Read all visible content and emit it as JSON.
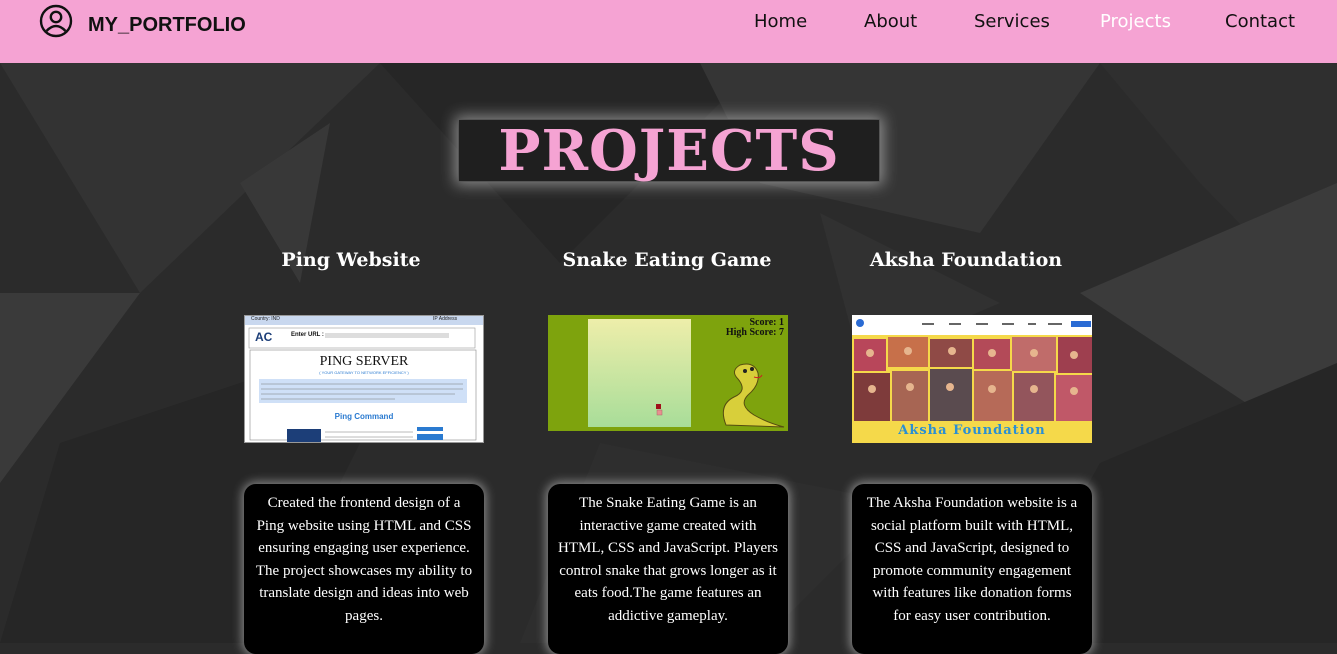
{
  "header": {
    "brand": "MY_PORTFOLIO",
    "brand_icon": "user-circle-icon",
    "nav": [
      {
        "label": "Home",
        "active": false
      },
      {
        "label": "About",
        "active": false
      },
      {
        "label": "Services",
        "active": false
      },
      {
        "label": "Projects",
        "active": true
      },
      {
        "label": "Contact",
        "active": false
      }
    ],
    "bg_color": "#f5a3d3"
  },
  "section": {
    "title": "PROJECTS",
    "title_color": "#f5a3d3"
  },
  "projects": [
    {
      "title": "Ping Website",
      "description": "Created the frontend design of a Ping website using HTML and CSS ensuring engaging user experience. The project showcases my ability to translate design and ideas into web pages.",
      "thumb": {
        "top_left": "Country: IND",
        "top_right": "IP Address",
        "logo": "AC",
        "url_label": "Enter URL :",
        "heading": "PING SERVER",
        "tagline": "( YOUR GATEWAY TO NETWORK EFFICIENCY )",
        "command": "Ping Command"
      }
    },
    {
      "title": "Snake Eating Game",
      "description": "The Snake Eating Game is an interactive game created with HTML, CSS and JavaScript. Players control snake that grows longer as it eats food.The game features an addictive gameplay.",
      "thumb": {
        "score": "Score: 1",
        "high_score": "High Score: 7"
      }
    },
    {
      "title": "Aksha Foundation",
      "description": "The Aksha Foundation website is a social platform built with HTML, CSS and JavaScript, designed to promote community engagement with features like donation forms for easy user contribution.",
      "thumb": {
        "caption": "Aksha Foundation"
      }
    }
  ]
}
